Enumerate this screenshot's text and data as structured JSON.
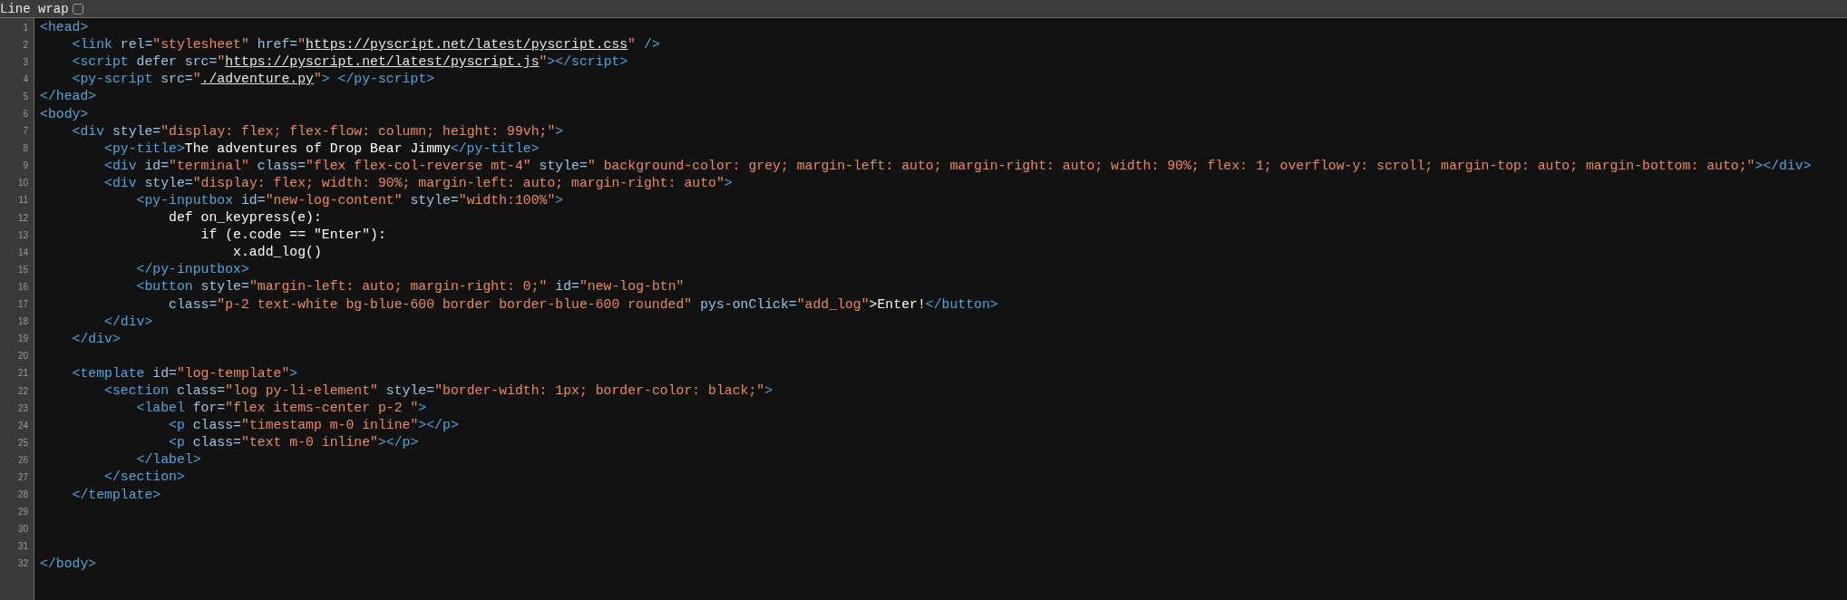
{
  "toolbar": {
    "line_wrap": {
      "label": "Line wrap",
      "checked": false
    }
  },
  "lines": [
    {
      "number": "1",
      "tokens": [
        {
          "kind": "tag",
          "text": "<head>"
        }
      ]
    },
    {
      "number": "2",
      "tokens": [
        {
          "kind": "tag",
          "text": "    <link"
        },
        {
          "kind": "attr",
          "text": " rel="
        },
        {
          "kind": "str",
          "text": "\"stylesheet\""
        },
        {
          "kind": "attr",
          "text": " href="
        },
        {
          "kind": "str",
          "text": "\""
        },
        {
          "kind": "url",
          "text": "https://pyscript.net/latest/pyscript.css"
        },
        {
          "kind": "str",
          "text": "\""
        },
        {
          "kind": "tag",
          "text": " />"
        }
      ]
    },
    {
      "number": "3",
      "tokens": [
        {
          "kind": "tag",
          "text": "    <script"
        },
        {
          "kind": "attr",
          "text": " defer src="
        },
        {
          "kind": "str",
          "text": "\""
        },
        {
          "kind": "url",
          "text": "https://pyscript.net/latest/pyscript.js"
        },
        {
          "kind": "str",
          "text": "\""
        },
        {
          "kind": "tag",
          "text": "></script>"
        }
      ]
    },
    {
      "number": "4",
      "tokens": [
        {
          "kind": "tag",
          "text": "    <py-script"
        },
        {
          "kind": "attr",
          "text": " src="
        },
        {
          "kind": "str",
          "text": "\""
        },
        {
          "kind": "url",
          "text": "./adventure.py"
        },
        {
          "kind": "str",
          "text": "\""
        },
        {
          "kind": "tag",
          "text": "> </py-script>"
        }
      ]
    },
    {
      "number": "5",
      "tokens": [
        {
          "kind": "tag",
          "text": "</head>"
        }
      ]
    },
    {
      "number": "6",
      "tokens": [
        {
          "kind": "tag",
          "text": "<body>"
        }
      ]
    },
    {
      "number": "7",
      "tokens": [
        {
          "kind": "tag",
          "text": "    <div"
        },
        {
          "kind": "attr",
          "text": " style="
        },
        {
          "kind": "str",
          "text": "\"display: flex; flex-flow: column; height: 99vh;\""
        },
        {
          "kind": "tag",
          "text": ">"
        }
      ]
    },
    {
      "number": "8",
      "tokens": [
        {
          "kind": "tag",
          "text": "        <py-title>"
        },
        {
          "kind": "text",
          "text": "The adventures of Drop Bear Jimmy"
        },
        {
          "kind": "tag",
          "text": "</py-title>"
        }
      ]
    },
    {
      "number": "9",
      "tokens": [
        {
          "kind": "tag",
          "text": "        <div"
        },
        {
          "kind": "attr",
          "text": " id="
        },
        {
          "kind": "str",
          "text": "\"terminal\""
        },
        {
          "kind": "attr",
          "text": " class="
        },
        {
          "kind": "str",
          "text": "\"flex flex-col-reverse mt-4\""
        },
        {
          "kind": "attr",
          "text": " style="
        },
        {
          "kind": "str",
          "text": "\" background-color: grey; margin-left: auto; margin-right: auto; width: 90%; flex: 1; overflow-y: scroll; margin-top: auto; margin-bottom: auto;\""
        },
        {
          "kind": "tag",
          "text": "></div>"
        }
      ]
    },
    {
      "number": "10",
      "tokens": [
        {
          "kind": "tag",
          "text": "        <div"
        },
        {
          "kind": "attr",
          "text": " style="
        },
        {
          "kind": "str",
          "text": "\"display: flex; width: 90%; margin-left: auto; margin-right: auto\""
        },
        {
          "kind": "tag",
          "text": ">"
        }
      ]
    },
    {
      "number": "11",
      "tokens": [
        {
          "kind": "tag",
          "text": "            <py-inputbox"
        },
        {
          "kind": "attr",
          "text": " id="
        },
        {
          "kind": "str",
          "text": "\"new-log-content\""
        },
        {
          "kind": "attr",
          "text": " style="
        },
        {
          "kind": "str",
          "text": "\"width:100%\""
        },
        {
          "kind": "tag",
          "text": ">"
        }
      ]
    },
    {
      "number": "12",
      "tokens": [
        {
          "kind": "text",
          "text": "                def on_keypress(e):"
        }
      ]
    },
    {
      "number": "13",
      "tokens": [
        {
          "kind": "text",
          "text": "                    if (e.code == \"Enter\"):"
        }
      ]
    },
    {
      "number": "14",
      "tokens": [
        {
          "kind": "text",
          "text": "                        x.add_log()"
        }
      ]
    },
    {
      "number": "15",
      "tokens": [
        {
          "kind": "tag",
          "text": "            </py-inputbox>"
        }
      ]
    },
    {
      "number": "16",
      "tokens": [
        {
          "kind": "tag",
          "text": "            <button"
        },
        {
          "kind": "attr",
          "text": " style="
        },
        {
          "kind": "str",
          "text": "\"margin-left: auto; margin-right: 0;\""
        },
        {
          "kind": "attr",
          "text": " id="
        },
        {
          "kind": "str",
          "text": "\"new-log-btn\""
        }
      ]
    },
    {
      "number": "17",
      "tokens": [
        {
          "kind": "attr",
          "text": "                class="
        },
        {
          "kind": "str",
          "text": "\"p-2 text-white bg-blue-600 border border-blue-600 rounded\""
        },
        {
          "kind": "attr",
          "text": " pys-onClick="
        },
        {
          "kind": "str",
          "text": "\"add_log\""
        },
        {
          "kind": "text",
          "text": ">Enter!"
        },
        {
          "kind": "tag",
          "text": "</button>"
        }
      ]
    },
    {
      "number": "18",
      "tokens": [
        {
          "kind": "tag",
          "text": "        </div>"
        }
      ]
    },
    {
      "number": "19",
      "tokens": [
        {
          "kind": "tag",
          "text": "    </div>"
        }
      ]
    },
    {
      "number": "20"
    },
    {
      "number": "21",
      "tokens": [
        {
          "kind": "tag",
          "text": "    <template"
        },
        {
          "kind": "attr",
          "text": " id="
        },
        {
          "kind": "str",
          "text": "\"log-template\""
        },
        {
          "kind": "tag",
          "text": ">"
        }
      ]
    },
    {
      "number": "22",
      "tokens": [
        {
          "kind": "tag",
          "text": "        <section"
        },
        {
          "kind": "attr",
          "text": " class="
        },
        {
          "kind": "str",
          "text": "\"log py-li-element\""
        },
        {
          "kind": "attr",
          "text": " style="
        },
        {
          "kind": "str",
          "text": "\"border-width: 1px; border-color: black;\""
        },
        {
          "kind": "tag",
          "text": ">"
        }
      ]
    },
    {
      "number": "23",
      "tokens": [
        {
          "kind": "tag",
          "text": "            <label"
        },
        {
          "kind": "attr",
          "text": " for="
        },
        {
          "kind": "str",
          "text": "\"flex items-center p-2 \""
        },
        {
          "kind": "tag",
          "text": ">"
        }
      ]
    },
    {
      "number": "24",
      "tokens": [
        {
          "kind": "tag",
          "text": "                <p"
        },
        {
          "kind": "attr",
          "text": " class="
        },
        {
          "kind": "str",
          "text": "\"timestamp m-0 inline\""
        },
        {
          "kind": "tag",
          "text": "></p>"
        }
      ]
    },
    {
      "number": "25",
      "tokens": [
        {
          "kind": "tag",
          "text": "                <p"
        },
        {
          "kind": "attr",
          "text": " class="
        },
        {
          "kind": "str",
          "text": "\"text m-0 inline\""
        },
        {
          "kind": "tag",
          "text": "></p>"
        }
      ]
    },
    {
      "number": "26",
      "tokens": [
        {
          "kind": "tag",
          "text": "            </label>"
        }
      ]
    },
    {
      "number": "27",
      "tokens": [
        {
          "kind": "tag",
          "text": "        </section>"
        }
      ]
    },
    {
      "number": "28",
      "tokens": [
        {
          "kind": "tag",
          "text": "    </template>"
        }
      ]
    },
    {
      "number": "29"
    },
    {
      "number": "30"
    },
    {
      "number": "31"
    },
    {
      "number": "32",
      "tokens": [
        {
          "kind": "tag",
          "text": "</body>"
        }
      ]
    }
  ]
}
